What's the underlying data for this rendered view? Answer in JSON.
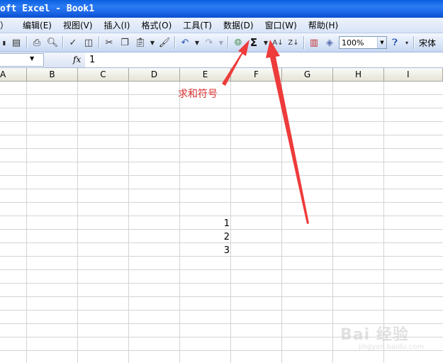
{
  "window": {
    "title": "oft Excel - Book1"
  },
  "menu": {
    "items": [
      "）",
      "编辑(E)",
      "视图(V)",
      "插入(I)",
      "格式(O)",
      "工具(T)",
      "数据(D)",
      "窗口(W)",
      "帮助(H)"
    ]
  },
  "toolbar": {
    "sigma_label": "Σ",
    "zoom_value": "100%",
    "font_name": "宋体"
  },
  "formula_bar": {
    "name_box": "",
    "fx_label": "fx",
    "content": "1"
  },
  "sheet": {
    "columns": [
      "A",
      "B",
      "C",
      "D",
      "E",
      "F",
      "G",
      "H",
      "I"
    ],
    "cells": [
      {
        "col": "E",
        "value": "1"
      },
      {
        "col": "E",
        "value": "2"
      },
      {
        "col": "E",
        "value": "3"
      }
    ]
  },
  "annotation": {
    "text": "求和符号",
    "color": "#d83030"
  },
  "watermark": {
    "main": "Bai 经验",
    "sub": "jingyan.baidu.com"
  },
  "colors": {
    "title_bar": "#1c66e6",
    "grid_line": "#d4d4d4",
    "annotation": "#d83030"
  }
}
